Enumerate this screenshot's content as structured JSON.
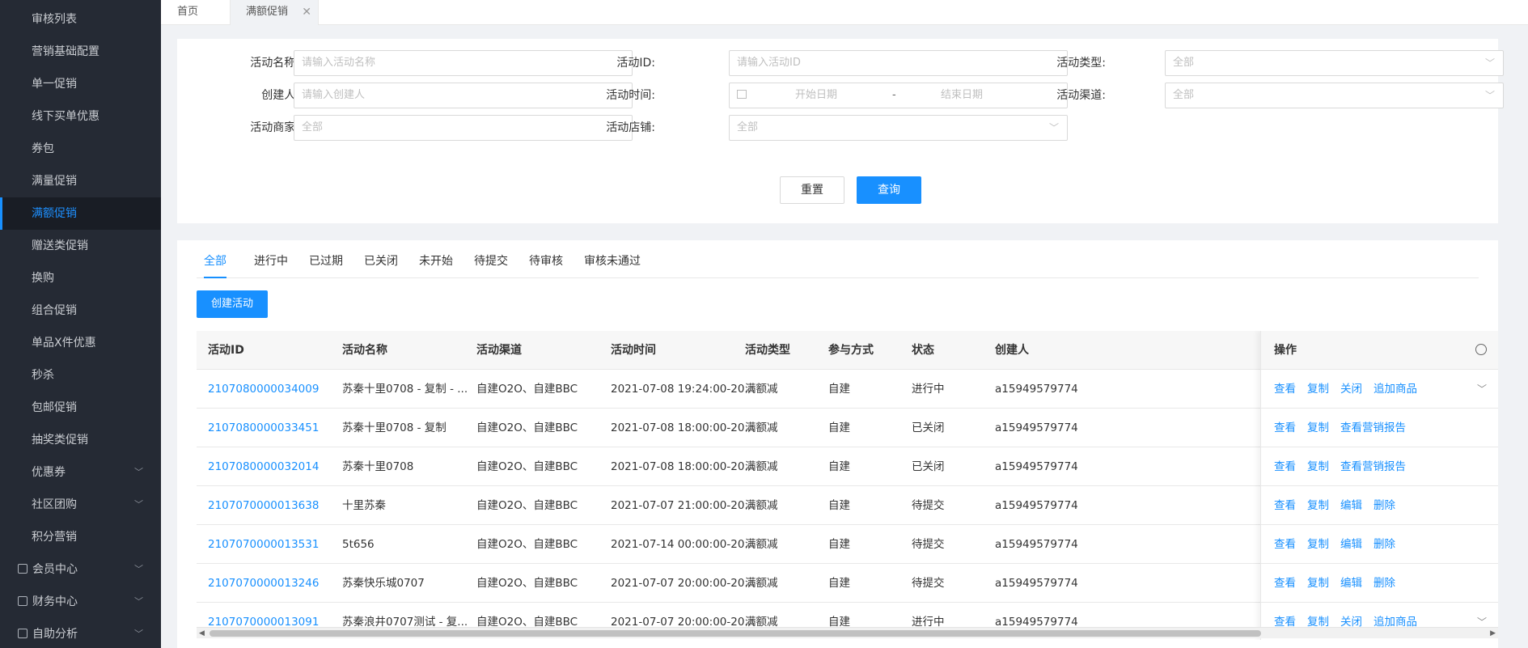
{
  "sidebar": {
    "items": [
      {
        "label": "审核列表"
      },
      {
        "label": "营销基础配置"
      },
      {
        "label": "单一促销"
      },
      {
        "label": "线下买单优惠"
      },
      {
        "label": "券包"
      },
      {
        "label": "满量促销"
      },
      {
        "label": "满额促销"
      },
      {
        "label": "赠送类促销"
      },
      {
        "label": "换购"
      },
      {
        "label": "组合促销"
      },
      {
        "label": "单品X件优惠"
      },
      {
        "label": "秒杀"
      },
      {
        "label": "包邮促销"
      },
      {
        "label": "抽奖类促销"
      },
      {
        "label": "优惠券"
      },
      {
        "label": "社区团购"
      },
      {
        "label": "积分营销"
      }
    ],
    "groups": [
      {
        "label": "会员中心"
      },
      {
        "label": "财务中心"
      },
      {
        "label": "自助分析"
      }
    ],
    "active": "满额促销"
  },
  "tabs": {
    "home": "首页",
    "current": "满额促销",
    "close": "✕"
  },
  "filter": {
    "name_label": "活动名称:",
    "name_placeholder": "请输入活动名称",
    "id_label": "活动ID:",
    "id_placeholder": "请输入活动ID",
    "type_label": "活动类型:",
    "type_value": "全部",
    "creator_label": "创建人:",
    "creator_placeholder": "请输入创建人",
    "time_label": "活动时间:",
    "time_start": "开始日期",
    "time_dash": "-",
    "time_end": "结束日期",
    "channel_label": "活动渠道:",
    "channel_value": "全部",
    "merchant_label": "活动商家:",
    "merchant_value": "全部",
    "store_label": "活动店铺:",
    "store_value": "全部",
    "reset": "重置",
    "query": "查询"
  },
  "status_tabs": [
    "全部",
    "进行中",
    "已过期",
    "已关闭",
    "未开始",
    "待提交",
    "待审核",
    "审核未通过"
  ],
  "create_button": "创建活动",
  "table": {
    "columns": [
      "活动ID",
      "活动名称",
      "活动渠道",
      "活动时间",
      "活动类型",
      "参与方式",
      "状态",
      "创建人",
      "操作"
    ],
    "rows": [
      {
        "id": "2107080000034009",
        "name": "苏秦十里0708 - 复制 - ...",
        "channel": "自建O2O、自建BBC",
        "time": "2021-07-08 19:24:00-20...",
        "type": "满额减",
        "mode": "自建",
        "status": "进行中",
        "creator": "a15949579774",
        "ops": [
          "查看",
          "复制",
          "关闭",
          "追加商品"
        ],
        "expand": true
      },
      {
        "id": "2107080000033451",
        "name": "苏秦十里0708 - 复制",
        "channel": "自建O2O、自建BBC",
        "time": "2021-07-08 18:00:00-20...",
        "type": "满额减",
        "mode": "自建",
        "status": "已关闭",
        "creator": "a15949579774",
        "ops": [
          "查看",
          "复制",
          "查看营销报告"
        ],
        "expand": false
      },
      {
        "id": "2107080000032014",
        "name": "苏秦十里0708",
        "channel": "自建O2O、自建BBC",
        "time": "2021-07-08 18:00:00-20...",
        "type": "满额减",
        "mode": "自建",
        "status": "已关闭",
        "creator": "a15949579774",
        "ops": [
          "查看",
          "复制",
          "查看营销报告"
        ],
        "expand": false
      },
      {
        "id": "2107070000013638",
        "name": "十里苏秦",
        "channel": "自建O2O、自建BBC",
        "time": "2021-07-07 21:00:00-20...",
        "type": "满额减",
        "mode": "自建",
        "status": "待提交",
        "creator": "a15949579774",
        "ops": [
          "查看",
          "复制",
          "编辑",
          "删除"
        ],
        "expand": false
      },
      {
        "id": "2107070000013531",
        "name": "5t656",
        "channel": "自建O2O、自建BBC",
        "time": "2021-07-14 00:00:00-20...",
        "type": "满额减",
        "mode": "自建",
        "status": "待提交",
        "creator": "a15949579774",
        "ops": [
          "查看",
          "复制",
          "编辑",
          "删除"
        ],
        "expand": false
      },
      {
        "id": "2107070000013246",
        "name": "苏秦快乐城0707",
        "channel": "自建O2O、自建BBC",
        "time": "2021-07-07 20:00:00-20...",
        "type": "满额减",
        "mode": "自建",
        "status": "待提交",
        "creator": "a15949579774",
        "ops": [
          "查看",
          "复制",
          "编辑",
          "删除"
        ],
        "expand": false
      },
      {
        "id": "2107070000013091",
        "name": "苏秦浪井0707测试 - 复...",
        "channel": "自建O2O、自建BBC",
        "time": "2021-07-07 20:00:00-20...",
        "type": "满额减",
        "mode": "自建",
        "status": "进行中",
        "creator": "a15949579774",
        "ops": [
          "查看",
          "复制",
          "关闭",
          "追加商品"
        ],
        "expand": true
      }
    ]
  },
  "colors": {
    "accent": "#1890ff",
    "sidebar_bg": "#252a34"
  }
}
